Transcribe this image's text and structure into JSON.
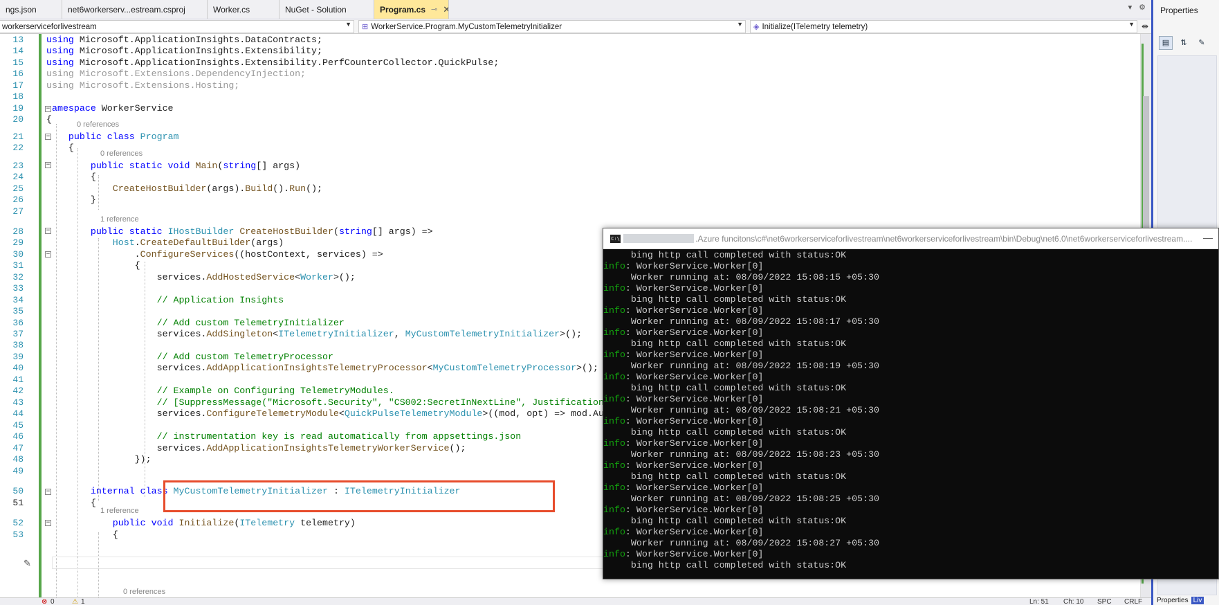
{
  "tabs": [
    {
      "label": "ngs.json",
      "width": 90
    },
    {
      "label": "net6workerserv...estream.csproj",
      "width": 210
    },
    {
      "label": "Worker.cs",
      "width": 104
    },
    {
      "label": "NuGet - Solution",
      "width": 137
    },
    {
      "label": "Program.cs",
      "active": true
    }
  ],
  "active_tab": {
    "label": "Program.cs",
    "pin": "⊸",
    "close": "✕"
  },
  "tabtools": {
    "dropdown": "▾",
    "settings": "⚙"
  },
  "navbar": {
    "project": "workerserviceforlivestream",
    "type": "WorkerService.Program.MyCustomTelemetryInitializer",
    "member": "Initialize(ITelemetry telemetry)"
  },
  "properties_panel": {
    "title": "Properties",
    "footer": [
      "Properties",
      "Liv"
    ]
  },
  "status_bar": {
    "errors": "0",
    "warnings": "1",
    "position": "Ln: 51",
    "column": "Ch: 10",
    "spc": "SPC",
    "crlf": "CRLF"
  },
  "code": {
    "line_numbers": [
      "13",
      "14",
      "15",
      "16",
      "17",
      "18",
      "19",
      "20",
      "21",
      "22",
      "23",
      "24",
      "25",
      "26",
      "27",
      "28",
      "29",
      "30",
      "31",
      "32",
      "33",
      "34",
      "35",
      "36",
      "37",
      "38",
      "39",
      "40",
      "41",
      "42",
      "43",
      "44",
      "45",
      "46",
      "47",
      "48",
      "49",
      "50",
      "51",
      "52",
      "53"
    ],
    "references": {
      "program": "0 references",
      "main": "0 references",
      "create_host_builder": "1 reference",
      "custom_initializer": "1 reference",
      "initialize": "0 references"
    }
  },
  "console": {
    "title_path": ".Azure funcitons\\c#\\net6workerserviceforlivestream\\net6workerserviceforlivestream\\bin\\Debug\\net6.0\\net6workerserviceforlivestream....",
    "lines": [
      {
        "lvl": "",
        "text": "     bing http call completed with status:OK"
      },
      {
        "lvl": "info",
        "text": ": WorkerService.Worker[0]"
      },
      {
        "lvl": "",
        "text": "     Worker running at: 08/09/2022 15:08:15 +05:30"
      },
      {
        "lvl": "info",
        "text": ": WorkerService.Worker[0]"
      },
      {
        "lvl": "",
        "text": "     bing http call completed with status:OK"
      },
      {
        "lvl": "info",
        "text": ": WorkerService.Worker[0]"
      },
      {
        "lvl": "",
        "text": "     Worker running at: 08/09/2022 15:08:17 +05:30"
      },
      {
        "lvl": "info",
        "text": ": WorkerService.Worker[0]"
      },
      {
        "lvl": "",
        "text": "     bing http call completed with status:OK"
      },
      {
        "lvl": "info",
        "text": ": WorkerService.Worker[0]"
      },
      {
        "lvl": "",
        "text": "     Worker running at: 08/09/2022 15:08:19 +05:30"
      },
      {
        "lvl": "info",
        "text": ": WorkerService.Worker[0]"
      },
      {
        "lvl": "",
        "text": "     bing http call completed with status:OK"
      },
      {
        "lvl": "info",
        "text": ": WorkerService.Worker[0]"
      },
      {
        "lvl": "",
        "text": "     Worker running at: 08/09/2022 15:08:21 +05:30"
      },
      {
        "lvl": "info",
        "text": ": WorkerService.Worker[0]"
      },
      {
        "lvl": "",
        "text": "     bing http call completed with status:OK"
      },
      {
        "lvl": "info",
        "text": ": WorkerService.Worker[0]"
      },
      {
        "lvl": "",
        "text": "     Worker running at: 08/09/2022 15:08:23 +05:30"
      },
      {
        "lvl": "info",
        "text": ": WorkerService.Worker[0]"
      },
      {
        "lvl": "",
        "text": "     bing http call completed with status:OK"
      },
      {
        "lvl": "info",
        "text": ": WorkerService.Worker[0]"
      },
      {
        "lvl": "",
        "text": "     Worker running at: 08/09/2022 15:08:25 +05:30"
      },
      {
        "lvl": "info",
        "text": ": WorkerService.Worker[0]"
      },
      {
        "lvl": "",
        "text": "     bing http call completed with status:OK"
      },
      {
        "lvl": "info",
        "text": ": WorkerService.Worker[0]"
      },
      {
        "lvl": "",
        "text": "     Worker running at: 08/09/2022 15:08:27 +05:30"
      },
      {
        "lvl": "info",
        "text": ": WorkerService.Worker[0]"
      },
      {
        "lvl": "",
        "text": "     bing http call completed with status:OK"
      }
    ]
  },
  "colors": {
    "accent_tab": "#ffe89a",
    "highlight_box": "#e74c2c",
    "change_bar": "#57a64a",
    "console_info": "#13a10e"
  }
}
